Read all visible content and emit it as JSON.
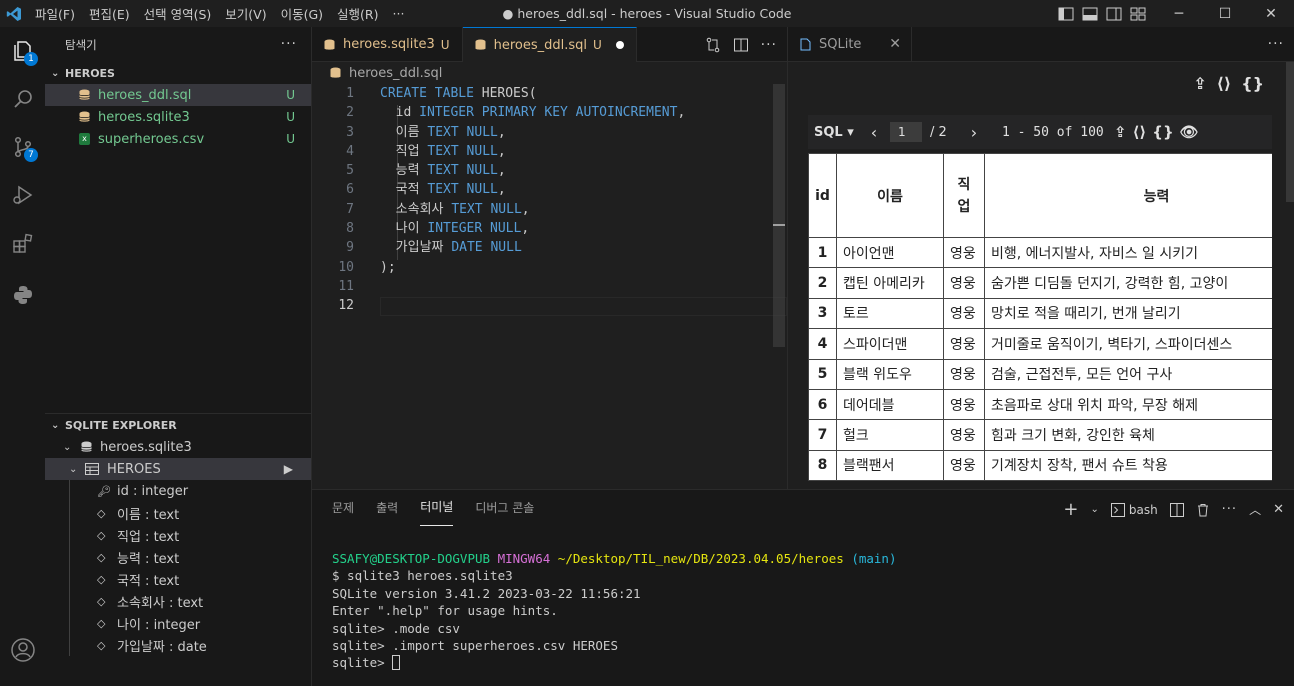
{
  "titlebar": {
    "menu": [
      "파일(F)",
      "편집(E)",
      "선택 영역(S)",
      "보기(V)",
      "이동(G)",
      "실행(R)",
      "···"
    ],
    "title": "● heroes_ddl.sql - heroes - Visual Studio Code"
  },
  "activity": {
    "explorer_badge": "1",
    "scm_badge": "7"
  },
  "sidebar": {
    "header": "탐색기",
    "more": "···",
    "folder": "HEROES",
    "files": [
      {
        "name": "heroes_ddl.sql",
        "status": "U"
      },
      {
        "name": "heroes.sqlite3",
        "status": "U"
      },
      {
        "name": "superheroes.csv",
        "status": "U"
      }
    ],
    "sqlite_title": "SQLITE EXPLORER",
    "db_name": "heroes.sqlite3",
    "table_name": "HEROES",
    "columns": [
      "id : integer",
      "이름 : text",
      "직업 : text",
      "능력 : text",
      "국적 : text",
      "소속회사 : text",
      "나이 : integer",
      "가입날짜 : date"
    ]
  },
  "editor": {
    "tabs": [
      {
        "label": "heroes.sqlite3",
        "status": "U"
      },
      {
        "label": "heroes_ddl.sql",
        "status": "U"
      }
    ],
    "breadcrumb": "heroes_ddl.sql",
    "line_numbers": [
      "1",
      "2",
      "3",
      "4",
      "5",
      "6",
      "7",
      "8",
      "9",
      "10",
      "11",
      "12"
    ],
    "lines": {
      "l1a": "CREATE TABLE",
      "l1b": " HEROES(",
      "l2a": "  id ",
      "l2b": "INTEGER",
      "l2c": " PRIMARY KEY AUTOINCREMENT",
      "l2d": ",",
      "l3a": "  이름 ",
      "l3b": "TEXT",
      "l3c": " NULL",
      "l3d": ",",
      "l4a": "  직업 ",
      "l4b": "TEXT",
      "l4c": " NULL",
      "l4d": ",",
      "l5a": "  능력 ",
      "l5b": "TEXT",
      "l5c": " NULL",
      "l5d": ",",
      "l6a": "  국적 ",
      "l6b": "TEXT",
      "l6c": " NULL",
      "l6d": ",",
      "l7a": "  소속회사 ",
      "l7b": "TEXT",
      "l7c": " NULL",
      "l7d": ",",
      "l8a": "  나이 ",
      "l8b": "INTEGER",
      "l8c": " NULL",
      "l8d": ",",
      "l9a": "  가입날짜 ",
      "l9b": "DATE",
      "l9c": " NULL",
      "l10": ");"
    }
  },
  "sqlite_view": {
    "tab_label": "SQLite",
    "sql_btn": "SQL ▾",
    "page_input": "1",
    "page_total": "/ 2",
    "range": "1 - 50 of 100",
    "headers": [
      "id",
      "이름",
      "직업",
      "능력"
    ],
    "rows": [
      [
        "1",
        "아이언맨",
        "영웅",
        "비행, 에너지발사, 자비스 일 시키기"
      ],
      [
        "2",
        "캡틴 아메리카",
        "영웅",
        "숨가쁜 디딤돌 던지기, 강력한 힘, 고양이"
      ],
      [
        "3",
        "토르",
        "영웅",
        "망치로 적을 때리기, 번개 날리기"
      ],
      [
        "4",
        "스파이더맨",
        "영웅",
        "거미줄로 움직이기, 벽타기, 스파이더센스"
      ],
      [
        "5",
        "블랙 위도우",
        "영웅",
        "검술, 근접전투, 모든 언어 구사"
      ],
      [
        "6",
        "데어데블",
        "영웅",
        "초음파로 상대 위치 파악, 무장 해제"
      ],
      [
        "7",
        "헐크",
        "영웅",
        "힘과 크기 변화, 강인한 육체"
      ],
      [
        "8",
        "블랙팬서",
        "영웅",
        "기계장치 장착, 팬서 슈트 착용"
      ]
    ]
  },
  "panel": {
    "tabs": [
      "문제",
      "출력",
      "터미널",
      "디버그 콘솔"
    ],
    "shell": "bash",
    "terminal": {
      "user": "SSAFY@DESKTOP-DOGVPUB",
      "env": "MINGW64",
      "path": "~/Desktop/TIL_new/DB/2023.04.05/heroes",
      "branch": "(main)",
      "lines": [
        "$ sqlite3 heroes.sqlite3",
        "SQLite version 3.41.2 2023-03-22 11:56:21",
        "Enter \".help\" for usage hints.",
        "sqlite> .mode csv",
        "sqlite> .import superheroes.csv HEROES"
      ],
      "prompt": "sqlite> "
    }
  }
}
